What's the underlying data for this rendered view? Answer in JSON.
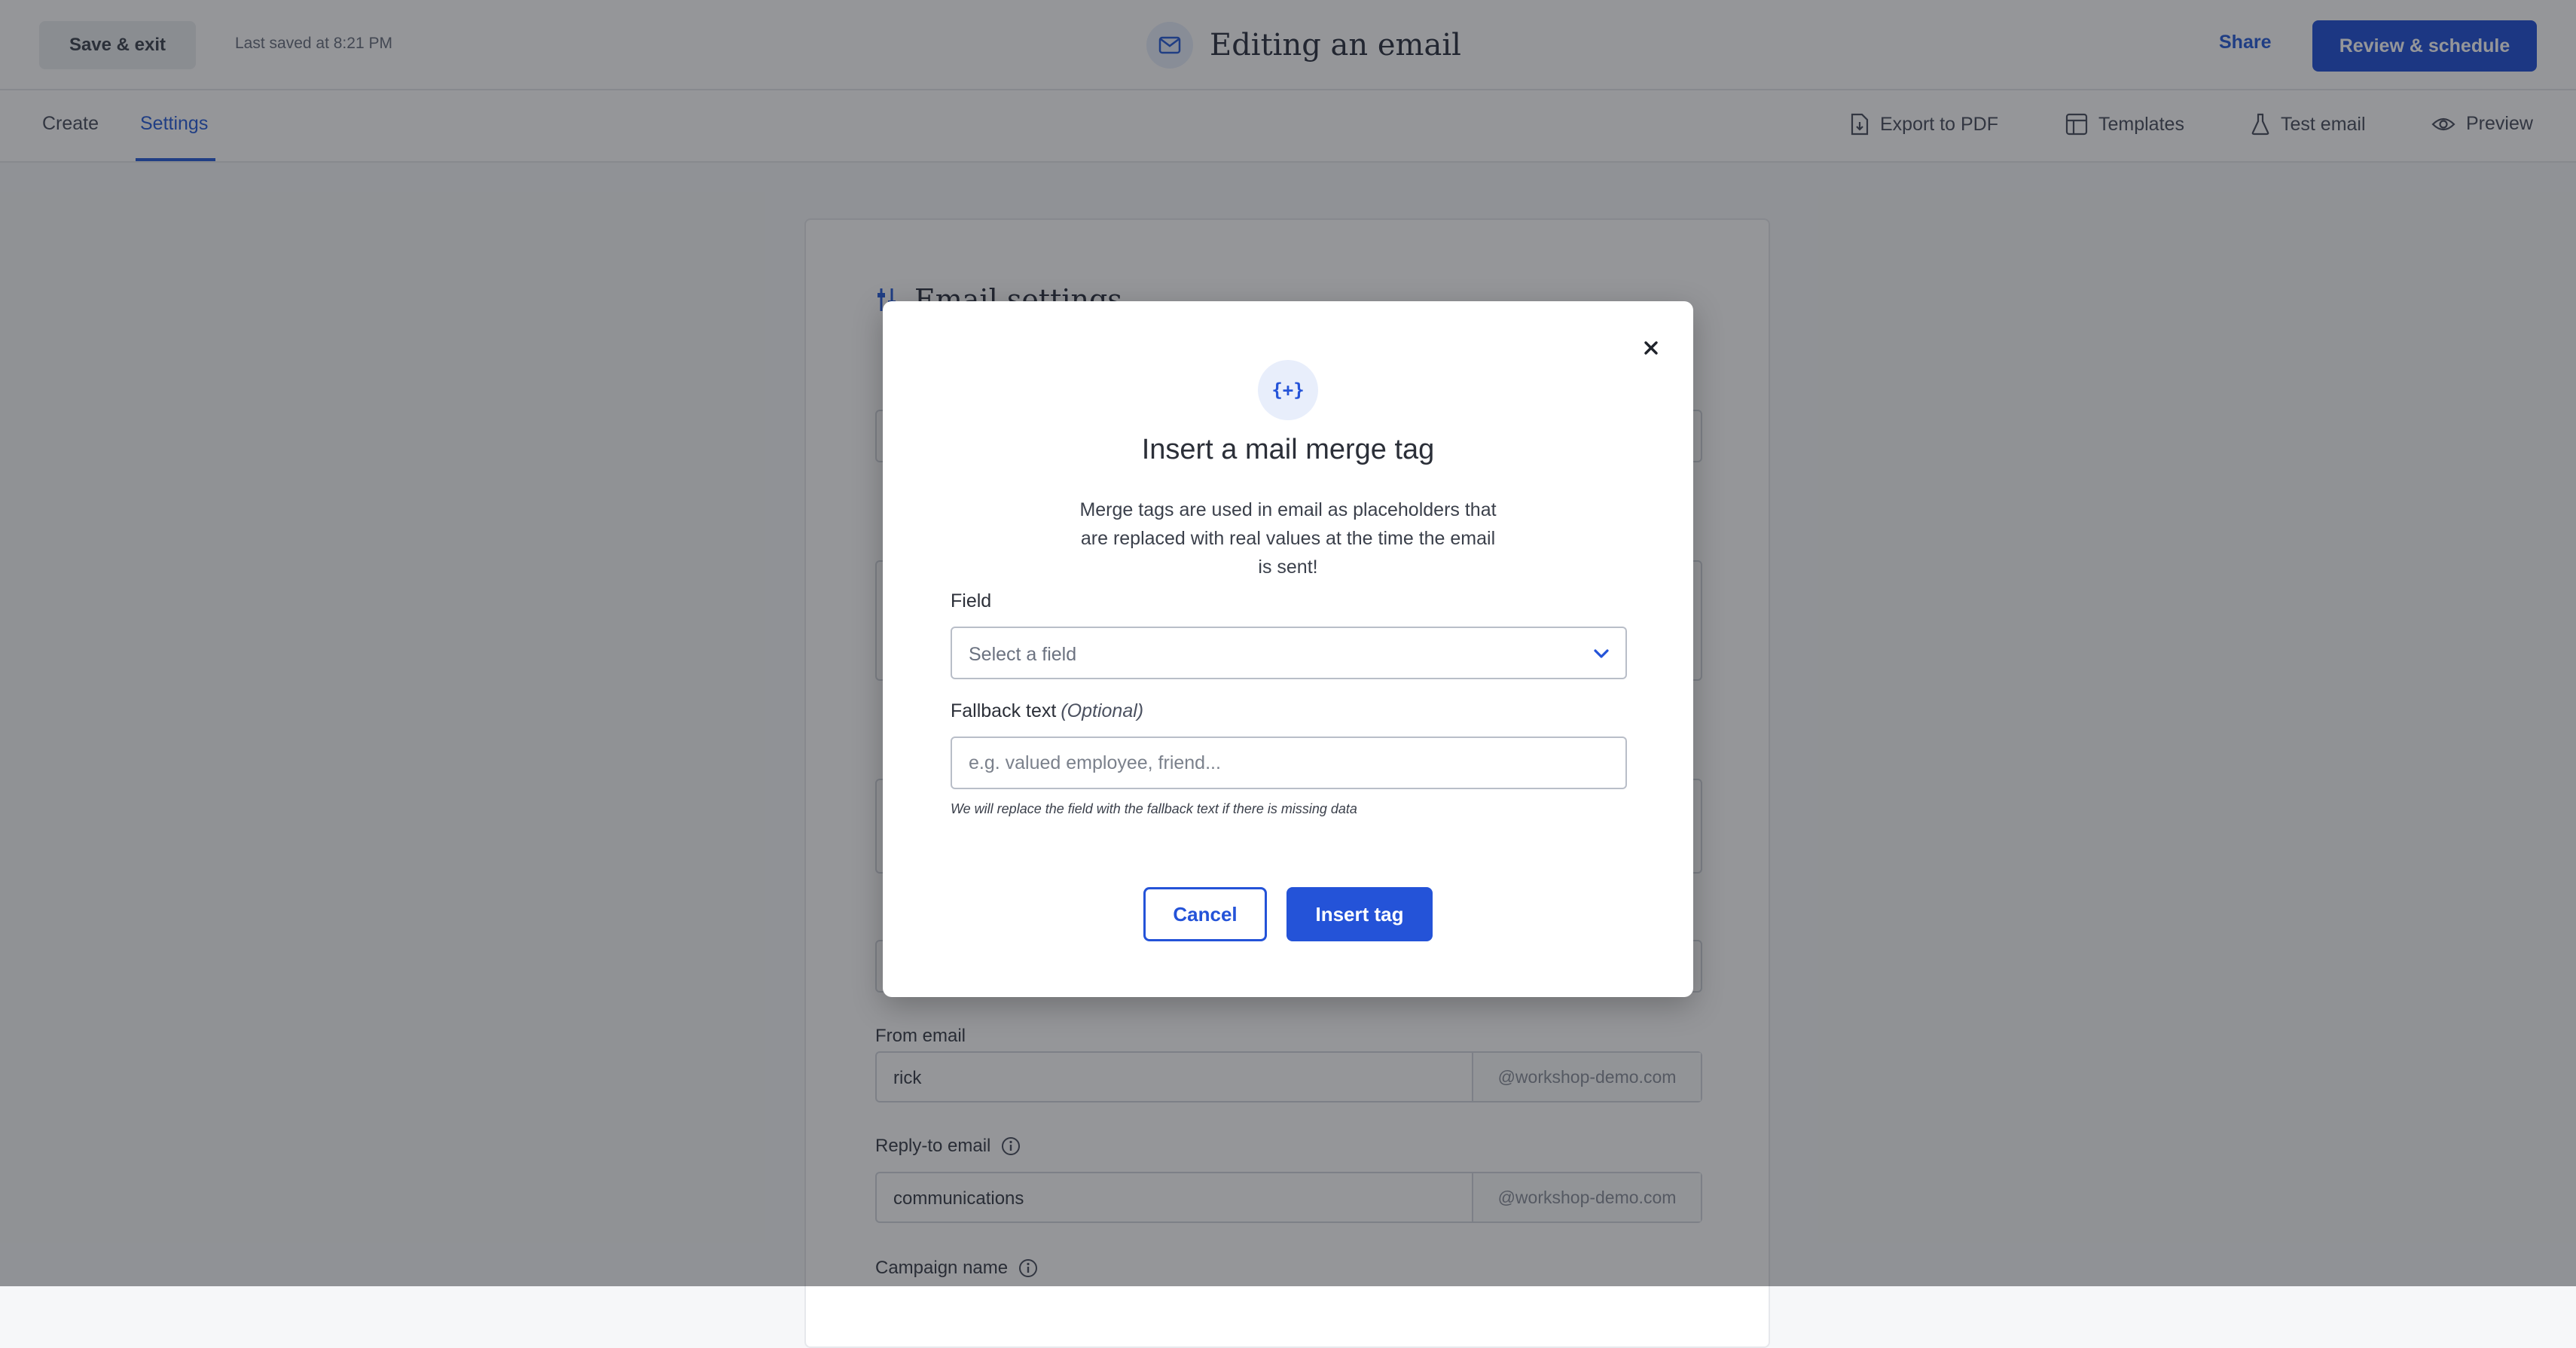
{
  "header": {
    "save_exit_label": "Save & exit",
    "last_saved": "Last saved at 8:21 PM",
    "title": "Editing an email",
    "title_icon": "mail-icon",
    "share_label": "Share",
    "review_label": "Review & schedule"
  },
  "subnav": {
    "tabs": [
      {
        "label": "Create",
        "active": false
      },
      {
        "label": "Settings",
        "active": true
      }
    ],
    "tools": [
      {
        "label": "Export to PDF",
        "icon": "file-export-icon"
      },
      {
        "label": "Templates",
        "icon": "templates-icon"
      },
      {
        "label": "Test email",
        "icon": "flask-icon"
      },
      {
        "label": "Preview",
        "icon": "eye-icon"
      }
    ]
  },
  "settings": {
    "heading": "Email settings",
    "from_email": {
      "label": "From email",
      "value": "rick",
      "suffix": "@workshop-demo.com"
    },
    "reply_to": {
      "label": "Reply-to email",
      "value": "communications",
      "suffix": "@workshop-demo.com"
    },
    "campaign_name": {
      "label": "Campaign name"
    }
  },
  "modal": {
    "icon_text": "{+}",
    "title": "Insert a mail merge tag",
    "description": "Merge tags are used in email as placeholders that are replaced with real values at the time the email is sent!",
    "field_label": "Field",
    "field_placeholder": "Select a field",
    "fallback_label": "Fallback text",
    "fallback_optional": "(Optional)",
    "fallback_placeholder": "e.g. valued employee, friend...",
    "fallback_hint": "We will replace the field with the fallback text if there is missing data",
    "cancel_label": "Cancel",
    "insert_label": "Insert tag"
  },
  "colors": {
    "accent": "#2453d8",
    "overlay": "rgba(20,22,28,0.45)"
  }
}
